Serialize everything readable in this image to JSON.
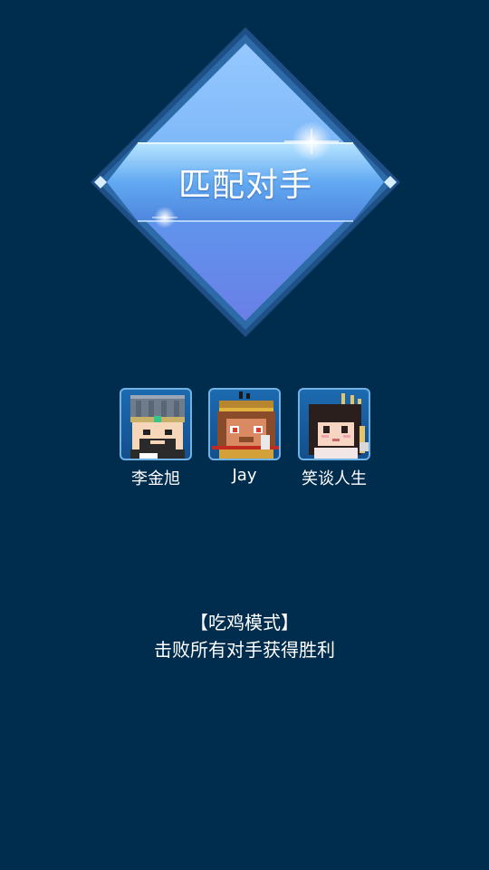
{
  "header": {
    "title": "匹配对手"
  },
  "players": [
    {
      "name": "李金旭",
      "avatar_icon": "helmet-warrior-icon"
    },
    {
      "name": "Jay",
      "avatar_icon": "monkey-king-icon"
    },
    {
      "name": "笑谈人生",
      "avatar_icon": "long-hair-girl-icon"
    }
  ],
  "mode": {
    "title": "【吃鸡模式】",
    "description": "击败所有对手获得胜利"
  },
  "colors": {
    "background": "#002c4d",
    "diamond_frame": "#1e4f86",
    "diamond_fill": "#6ea8ee",
    "avatar_border": "#6fb2e6"
  }
}
